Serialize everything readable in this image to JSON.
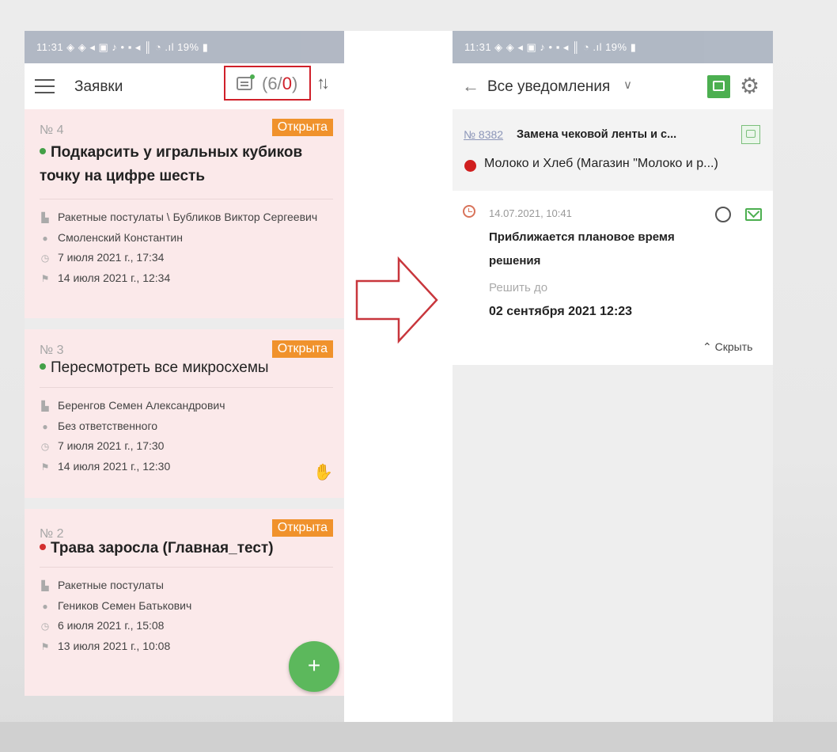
{
  "left": {
    "status_time": "11:31 ◈ ◈ ◂ ▣ ♪  •      ▪ ◂ ║ ◔ .ıl 19% ▮",
    "header": {
      "title": "Заявки",
      "notif_open": "(6/",
      "notif_zero": "0",
      "notif_close": ")"
    },
    "cards": [
      {
        "number": "№ 4",
        "status": "Открыта",
        "title": "Подкарсить у игральных кубиков точку на цифре шесть",
        "dot_color": "#43a047",
        "company": "Ракетные постулаты \\ Бубликов Виктор Сергеевич",
        "assignee": "Смоленский Константин",
        "created": "7 июля 2021 г., 17:34",
        "deadline": "14 июля 2021 г., 12:34"
      },
      {
        "number": "№ 3",
        "status": "Открыта",
        "title": "Пересмотреть все микросхемы",
        "dot_color": "#43a047",
        "company": "Беренгов Семен Александрович",
        "assignee": "Без ответственного",
        "created": "7 июля 2021 г., 17:30",
        "deadline": "14 июля 2021 г., 12:30"
      },
      {
        "number": "№ 2",
        "status": "Открыта",
        "title": "Трава заросла (Главная_тест)",
        "dot_color": "#d32f2f",
        "company": "Ракетные постулаты",
        "assignee": "Геников Семен Батькович",
        "created": "6 июля 2021 г., 15:08",
        "deadline": "13 июля 2021 г., 10:08"
      }
    ],
    "fab": "+"
  },
  "right": {
    "status_time": "11:31 ◈ ◈ ◂ ▣ ♪  •      ▪ ◂ ║ ◔ .ıl 19% ▮",
    "header": {
      "title": "Все уведомления"
    },
    "task": {
      "number": "№ 8382",
      "title": "Замена чековой ленты и с...",
      "client": "Молоко и Хлеб (Магазин \"Молоко и р...)"
    },
    "notification": {
      "datetime": "14.07.2021, 10:41",
      "title": "Приближается плановое время решения",
      "due_label": "Решить до",
      "due_value": "02 сентября 2021 12:23",
      "hide": "⌃ Скрыть"
    }
  },
  "colors": {
    "accent_green": "#4caf50",
    "status_orange": "#f0922c",
    "highlight_red": "#d0202a",
    "card_pink": "#fbe9ea"
  }
}
